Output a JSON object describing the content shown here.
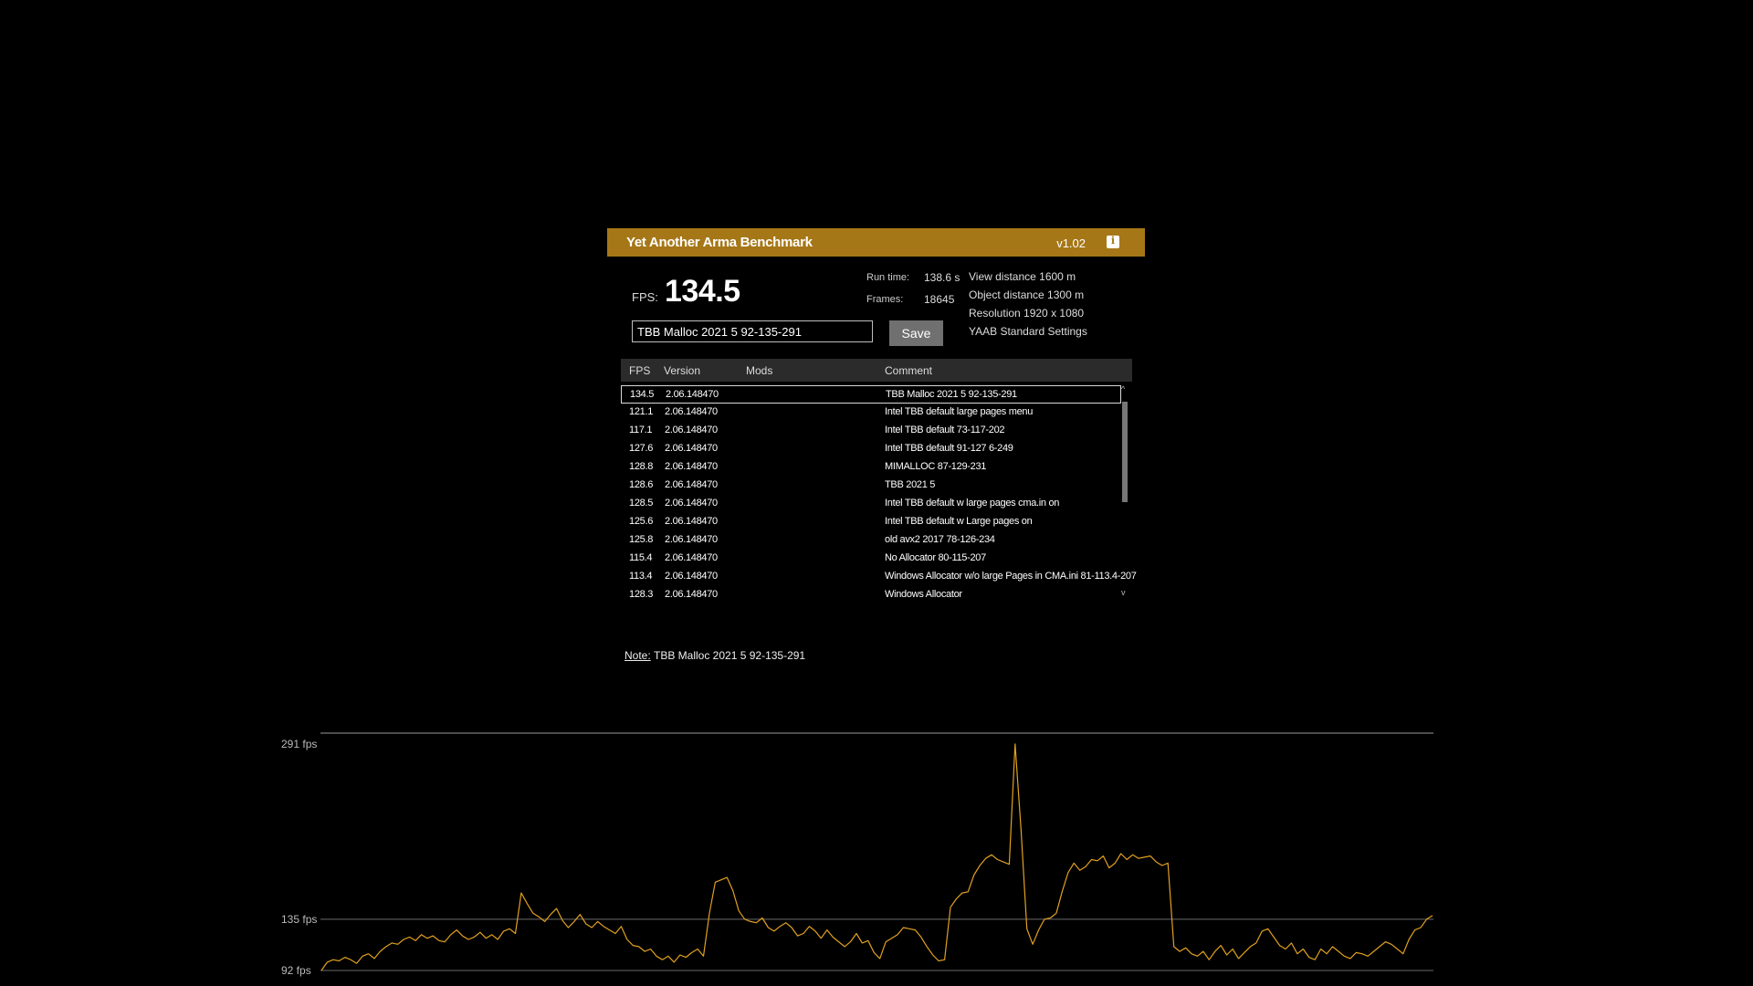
{
  "app": {
    "title": "Yet Another Arma Benchmark",
    "version": "v1.02",
    "info_icon": "info-icon"
  },
  "result": {
    "fps_label": "FPS:",
    "fps_value": "134.5",
    "run_time_label": "Run time:",
    "run_time_value": "138.6 s",
    "frames_label": "Frames:",
    "frames_value": "18645"
  },
  "settings": [
    "View distance 1600 m",
    "Object distance 1300 m",
    "Resolution 1920 x 1080",
    "YAAB Standard Settings"
  ],
  "comment_input": {
    "value": "TBB Malloc 2021 5 92-135-291"
  },
  "save_button": "Save",
  "table": {
    "headers": {
      "fps": "FPS",
      "version": "Version",
      "mods": "Mods",
      "comment": "Comment"
    },
    "rows": [
      {
        "fps": "134.5",
        "version": "2.06.148470",
        "mods": "",
        "comment": "TBB Malloc 2021 5 92-135-291",
        "selected": true
      },
      {
        "fps": "121.1",
        "version": "2.06.148470",
        "mods": "",
        "comment": "Intel TBB default large pages menu"
      },
      {
        "fps": "117.1",
        "version": "2.06.148470",
        "mods": "",
        "comment": "Intel TBB default 73-117-202"
      },
      {
        "fps": "127.6",
        "version": "2.06.148470",
        "mods": "",
        "comment": "Intel TBB default 91-127 6-249"
      },
      {
        "fps": "128.8",
        "version": "2.06.148470",
        "mods": "",
        "comment": "MIMALLOC 87-129-231"
      },
      {
        "fps": "128.6",
        "version": "2.06.148470",
        "mods": "",
        "comment": "TBB 2021 5"
      },
      {
        "fps": "128.5",
        "version": "2.06.148470",
        "mods": "",
        "comment": "Intel TBB default w large pages cma.in on"
      },
      {
        "fps": "125.6",
        "version": "2.06.148470",
        "mods": "",
        "comment": "Intel TBB default w Large pages on"
      },
      {
        "fps": "125.8",
        "version": "2.06.148470",
        "mods": "",
        "comment": "old avx2 2017 78-126-234"
      },
      {
        "fps": "115.4",
        "version": "2.06.148470",
        "mods": "",
        "comment": "No Allocator 80-115-207"
      },
      {
        "fps": "113.4",
        "version": "2.06.148470",
        "mods": "",
        "comment": "Windows Allocator w/o large Pages in CMA.ini 81-113.4-207"
      },
      {
        "fps": "128.3",
        "version": "2.06.148470",
        "mods": "",
        "comment": "Windows Allocator"
      }
    ]
  },
  "note": {
    "label": "Note:",
    "text": "TBB Malloc 2021 5 92-135-291"
  },
  "chart_data": {
    "type": "line",
    "y_tick_labels": [
      "291 fps",
      "135 fps",
      "92 fps"
    ],
    "y_ticks": [
      291,
      135,
      92
    ],
    "ylim": [
      92,
      291
    ],
    "grid": true,
    "color": "#e0a020",
    "values": [
      92,
      99,
      101,
      100,
      103,
      101,
      98,
      104,
      106,
      102,
      108,
      112,
      115,
      114,
      118,
      120,
      117,
      122,
      119,
      121,
      117,
      116,
      122,
      126,
      121,
      118,
      120,
      124,
      119,
      122,
      118,
      125,
      127,
      123,
      157,
      148,
      140,
      137,
      133,
      139,
      144,
      134,
      128,
      133,
      139,
      131,
      128,
      133,
      129,
      126,
      123,
      129,
      118,
      113,
      112,
      108,
      110,
      104,
      101,
      104,
      99,
      105,
      103,
      107,
      110,
      104,
      140,
      166,
      168,
      170,
      159,
      142,
      135,
      133,
      132,
      136,
      128,
      125,
      129,
      132,
      128,
      121,
      123,
      129,
      125,
      119,
      126,
      120,
      116,
      112,
      116,
      123,
      115,
      117,
      107,
      102,
      116,
      119,
      122,
      128,
      127,
      126,
      120,
      112,
      105,
      100,
      101,
      145,
      152,
      157,
      158,
      172,
      180,
      186,
      189,
      185,
      183,
      181,
      282,
      210,
      127,
      114,
      126,
      135,
      136,
      140,
      158,
      174,
      182,
      176,
      179,
      185,
      184,
      188,
      178,
      182,
      190,
      185,
      189,
      186,
      187,
      188,
      183,
      180,
      182,
      112,
      108,
      111,
      106,
      104,
      108,
      101,
      108,
      113,
      105,
      110,
      102,
      107,
      112,
      115,
      125,
      127,
      120,
      113,
      110,
      115,
      106,
      110,
      103,
      101,
      110,
      106,
      112,
      108,
      104,
      102,
      107,
      106,
      104,
      108,
      112,
      116,
      114,
      110,
      106,
      118,
      126,
      128,
      135,
      138
    ]
  }
}
